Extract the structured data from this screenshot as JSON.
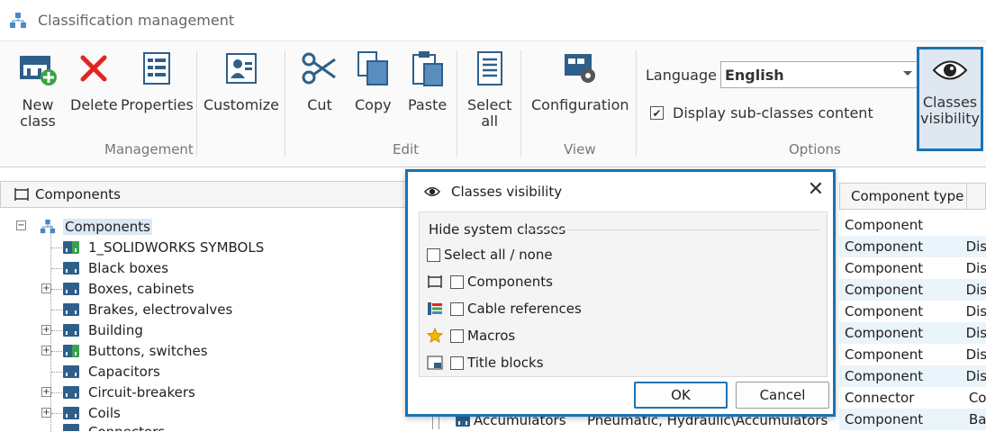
{
  "window": {
    "title": "Classification management"
  },
  "ribbon": {
    "buttons": {
      "new_class": "New\nclass",
      "delete": "Delete",
      "properties": "Properties",
      "customize": "Customize",
      "cut": "Cut",
      "copy": "Copy",
      "paste": "Paste",
      "select_all": "Select\nall",
      "configuration": "Configuration",
      "classes_visibility": "Classes\nvisibility"
    },
    "groups": {
      "management": "Management",
      "edit": "Edit",
      "view": "View",
      "options": "Options"
    },
    "language_label": "Language",
    "language_value": "English",
    "display_subclasses_label": "Display sub-classes content",
    "display_subclasses_checked": true
  },
  "tree": {
    "header": "Components",
    "root": "Components",
    "items": [
      "1_SOLIDWORKS SYMBOLS",
      "Black boxes",
      "Boxes, cabinets",
      "Brakes, electrovalves",
      "Building",
      "Buttons, switches",
      "Capacitors",
      "Circuit-breakers",
      "Coils",
      "Connectors"
    ]
  },
  "list": {
    "column_header": "Component type",
    "rows": [
      {
        "type": "Component",
        "extra": ""
      },
      {
        "type": "Component",
        "extra": "Dis"
      },
      {
        "type": "Component",
        "extra": "Dis"
      },
      {
        "type": "Component",
        "extra": "Dis"
      },
      {
        "type": "Component",
        "extra": "Dis"
      },
      {
        "type": "Component",
        "extra": "Dis"
      },
      {
        "type": "Component",
        "extra": "Dis"
      },
      {
        "type": "Connector",
        "extra": "Co"
      },
      {
        "type": "Component",
        "extra": "Ba"
      }
    ],
    "partial_row": {
      "name": "Accumulators",
      "path": "Pneumatic, Hydraulic\\Accumulators"
    }
  },
  "dialog": {
    "title": "Classes visibility",
    "group_label": "Hide system classes",
    "select_all": "Select all / none",
    "options": [
      "Components",
      "Cable references",
      "Macros",
      "Title blocks"
    ],
    "ok": "OK",
    "cancel": "Cancel"
  },
  "colors": {
    "accent": "#1a73b5",
    "folder": "#2e5f8a",
    "green": "#3aa34a",
    "row_alt": "#eaf4fb"
  }
}
